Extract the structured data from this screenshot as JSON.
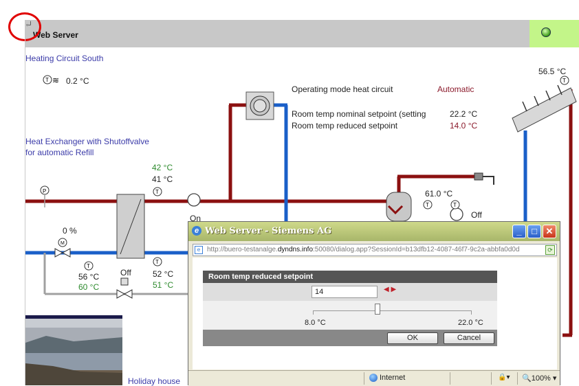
{
  "header": {
    "title": "Web Server",
    "corner_icon": "window-restore-icon",
    "status_led": "green-led-icon",
    "accent_color": "#c3f589"
  },
  "plant": {
    "circuit_title": "Heating Circuit South",
    "outdoor_temp": "0.2 °C",
    "heat_exchanger_line1": "Heat Exchanger with Shutoffvalve",
    "heat_exchanger_line2": "for automatic Refill",
    "supply_temp_setpoint": "42 °C",
    "supply_temp_actual": "41 °C",
    "valve_position": "0 %",
    "pump_state": "On",
    "primary_return_actual": "56 °C",
    "primary_return_setpoint": "60 °C",
    "shutoff_state": "Off",
    "secondary_return_actual": "52 °C",
    "secondary_return_setpoint": "51 °C",
    "solar_temp": "56.5 °C",
    "tank_temp": "61.0 °C",
    "tank_pump_state": "Off",
    "holiday_link": "Holiday house"
  },
  "settings": {
    "mode_label": "Operating mode heat circuit",
    "mode_value": "Automatic",
    "nominal_label": "Room temp nominal setpoint (setting",
    "nominal_value": "22.2 °C",
    "reduced_label": "Room temp reduced setpoint",
    "reduced_value": "14.0 °C"
  },
  "popup": {
    "title": "Web Server - Siemens AG",
    "address_prefix": "http://buero-testanalge.",
    "address_domain": "dyndns.info",
    "address_suffix": ":50080/dialog.app?SessionId=b13dfb12-4087-46f7-9c2a-abbfa0d0d",
    "dialog_title": "Room temp reduced setpoint",
    "input_value": "14",
    "slider_value": 14,
    "slider_min": "8.0 °C",
    "slider_max": "22.0 °C",
    "ok_label": "OK",
    "cancel_label": "Cancel",
    "status_zone": "Internet",
    "zoom": "100%",
    "zoom_glyph": "🔍",
    "minimize_glyph": "_",
    "maximize_glyph": "□",
    "close_glyph": "✕"
  },
  "colors": {
    "pipe_hot": "#8b1010",
    "pipe_cold": "#1a5fc8",
    "pipe_neutral": "#a0a0a0"
  }
}
